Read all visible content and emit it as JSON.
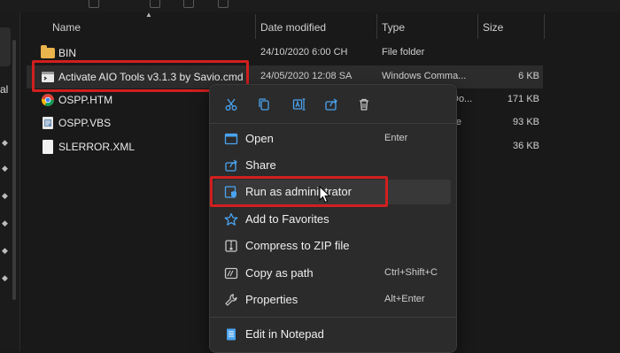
{
  "columns": {
    "name": "Name",
    "date_modified": "Date modified",
    "type": "Type",
    "size": "Size"
  },
  "left_nav": {
    "cut_text": "al"
  },
  "files": [
    {
      "name": "BIN",
      "date": "24/10/2020 6:00 CH",
      "type": "File folder",
      "size": "",
      "icon": "folder-icon"
    },
    {
      "name": "Activate AIO Tools v3.1.3 by Savio.cmd",
      "date": "24/05/2020 12:08 SA",
      "type": "Windows Comma...",
      "size": "6 KB",
      "icon": "cmd-file-icon"
    },
    {
      "name": "OSPP.HTM",
      "date": "",
      "type": "Do...",
      "size": "171 KB",
      "icon": "chrome-icon"
    },
    {
      "name": "OSPP.VBS",
      "date": "",
      "type": "ile",
      "size": "93 KB",
      "icon": "vbs-file-icon"
    },
    {
      "name": "SLERROR.XML",
      "date": "",
      "type": "",
      "size": "36 KB",
      "icon": "xml-file-icon"
    }
  ],
  "context_menu": {
    "quick_actions": [
      "cut-icon",
      "copy-icon",
      "rename-icon",
      "share-icon",
      "delete-icon"
    ],
    "items": [
      {
        "label": "Open",
        "shortcut": "Enter",
        "icon": "open-icon"
      },
      {
        "label": "Share",
        "shortcut": "",
        "icon": "share-icon"
      },
      {
        "label": "Run as administrator",
        "shortcut": "",
        "icon": "run-as-admin-icon"
      },
      {
        "label": "Add to Favorites",
        "shortcut": "",
        "icon": "star-icon"
      },
      {
        "label": "Compress to ZIP file",
        "shortcut": "",
        "icon": "zip-icon"
      },
      {
        "label": "Copy as path",
        "shortcut": "Ctrl+Shift+C",
        "icon": "copy-path-icon"
      },
      {
        "label": "Properties",
        "shortcut": "Alt+Enter",
        "icon": "wrench-icon"
      },
      {
        "label": "Edit in Notepad",
        "shortcut": "",
        "icon": "notepad-icon"
      }
    ]
  },
  "colors": {
    "background": "#191919",
    "menu_background": "#2b2b2b",
    "highlight_red": "#d11f1f",
    "accent_blue": "#4aa3f0",
    "folder_yellow": "#e9b44c"
  }
}
